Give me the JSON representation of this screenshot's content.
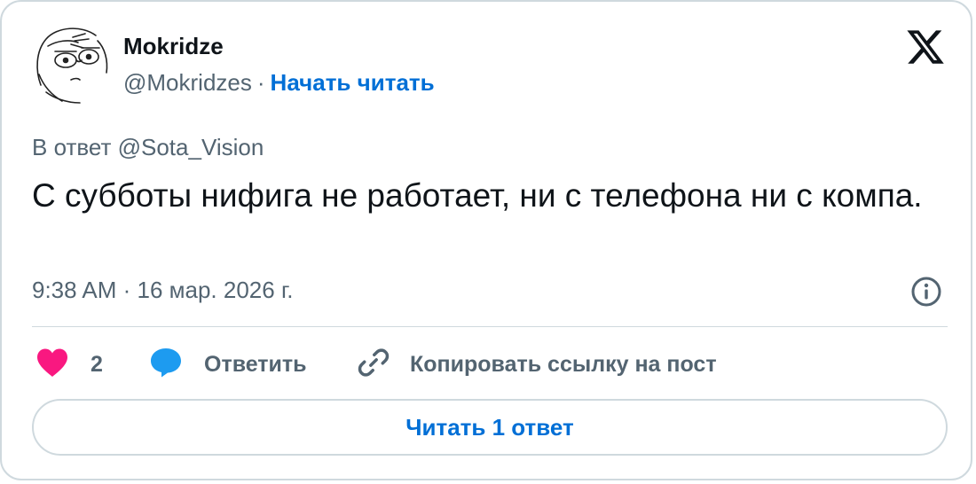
{
  "author": {
    "name": "Mokridze",
    "handle": "@Mokridzes",
    "separator": "·",
    "follow_label": "Начать читать"
  },
  "brand_icon": "x-logo-icon",
  "reply_to": "В ответ @Sota_Vision",
  "tweet": {
    "text": "С субботы нифига не работает, ни с телефона ни с компа."
  },
  "timestamp": "9:38 AM · 16 мар. 2026 г.",
  "actions": {
    "like": {
      "icon": "heart-icon",
      "count": "2"
    },
    "reply": {
      "icon": "speech-bubble-icon",
      "label": "Ответить"
    },
    "copy": {
      "icon": "link-icon",
      "label": "Копировать ссылку на пост"
    }
  },
  "read_replies_label": "Читать 1 ответ",
  "colors": {
    "text": "#0f1419",
    "muted": "#536471",
    "link": "#006fd6",
    "like": "#f91880",
    "reply_icon": "#1d9bf0",
    "border": "#cfd9de"
  }
}
